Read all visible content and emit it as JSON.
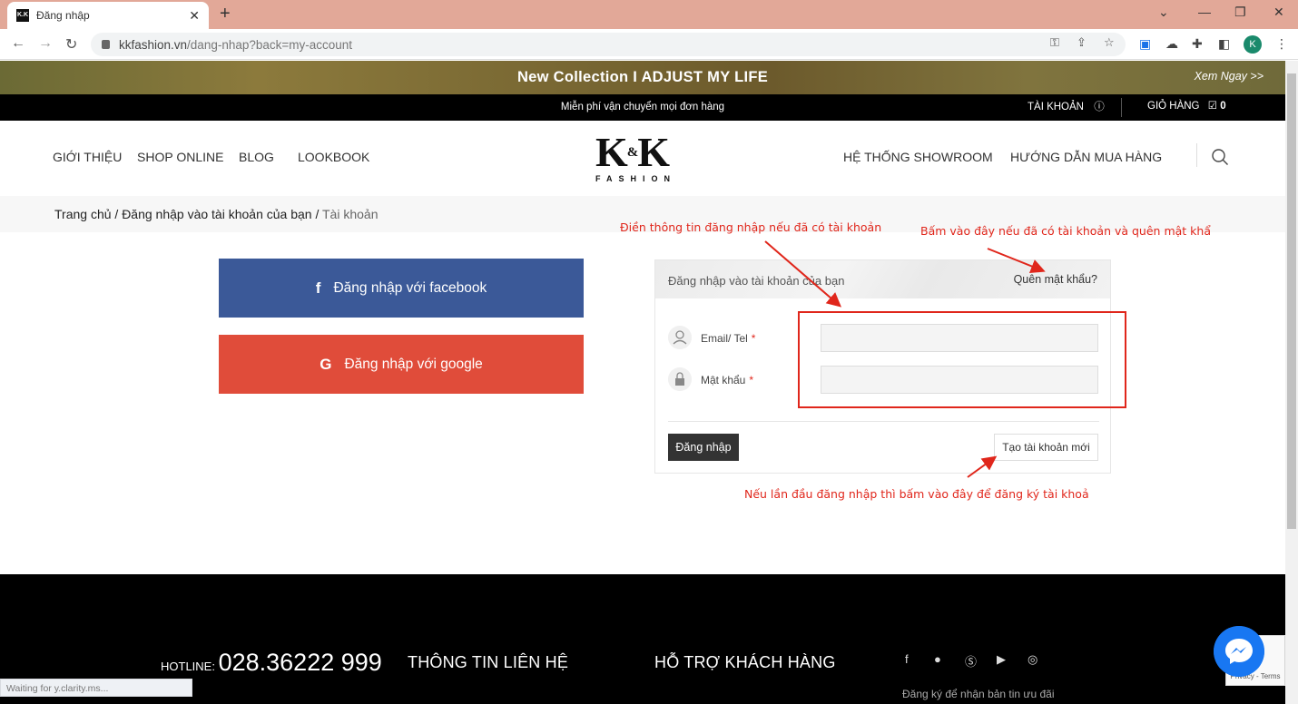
{
  "browser": {
    "tab_title": "Đăng nhập",
    "favicon_text": "K.K",
    "url_host": "kkfashion.vn",
    "url_path": "/dang-nhap?back=my-account",
    "profile_initial": "K"
  },
  "banner": {
    "title": "New Collection  I  ADJUST MY LIFE",
    "link": "Xem Ngay >>"
  },
  "topbar": {
    "shipping": "Miễn phí vận chuyển mọi đơn hàng",
    "account": "TÀI KHOẢN",
    "cart": "GIỎ HÀNG",
    "cart_count": "0"
  },
  "nav": {
    "left": [
      "GIỚI THIỆU",
      "SHOP ONLINE",
      "BLOG",
      "LOOKBOOK"
    ],
    "right": [
      "HỆ THỐNG SHOWROOM",
      "HƯỚNG DẪN MUA HÀNG"
    ]
  },
  "logo": {
    "main": "K",
    "amp": "&",
    "main2": "K",
    "sub": "FASHION"
  },
  "breadcrumb": {
    "home": "Trang chủ",
    "sep": " / ",
    "login": "Đăng nhập vào tài khoản của bạn",
    "current": "Tài khoản"
  },
  "social": {
    "facebook_label": "Đăng nhập với facebook",
    "google_label": "Đăng nhập với google"
  },
  "login": {
    "title": "Đăng nhập vào tài khoản của bạn",
    "forgot": "Quên mật khẩu?",
    "email_label": "Email/ Tel",
    "password_label": "Mật khẩu",
    "required": "*",
    "submit": "Đăng nhập",
    "register": "Tạo tài khoản mới"
  },
  "annotations": {
    "fill_info": "Điền thông tin đăng nhập nếu đã có tài khoản",
    "forgot_hint": "Bấm vào đây nếu đã có tài khoản và quên mật khẩu",
    "register_hint": "Nếu lần đầu đăng nhập thì bấm vào đây để đăng ký tài khoản"
  },
  "footer": {
    "hotline_label": "HOTLINE:",
    "hotline_number": "028.36222 999",
    "contact": "THÔNG TIN LIÊN HỆ",
    "support": "HỖ TRỢ KHÁCH HÀNG",
    "newsletter": "Đăng ký để nhận bản tin ưu đãi"
  },
  "status_text": "Waiting for y.clarity.ms...",
  "recaptcha_text": "Privacy - Terms",
  "colors": {
    "facebook": "#3b5998",
    "google": "#e04c3a",
    "annotation": "#e0261b"
  }
}
